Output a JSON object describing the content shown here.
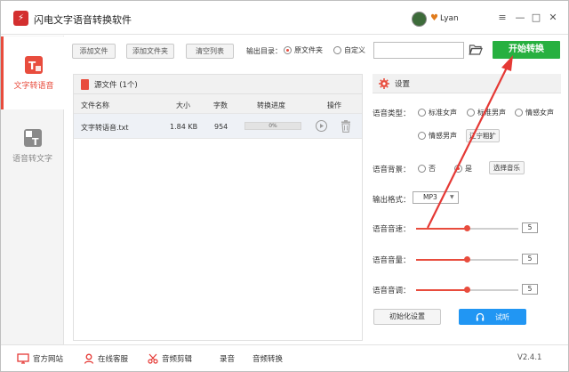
{
  "app": {
    "title": "闪电文字语音转换软件",
    "logo_glyph": "⚡",
    "user": "Lyan"
  },
  "window": {
    "menu_glyph": "≡",
    "minimize_glyph": "—",
    "maximize_glyph": "□",
    "close_glyph": "✕"
  },
  "sidebar": {
    "items": [
      {
        "label": "文字转语音",
        "active": true
      },
      {
        "label": "语音转文字",
        "active": false
      }
    ]
  },
  "toolbar": {
    "add_file": "添加文件",
    "add_folder": "添加文件夹",
    "clear_list": "清空列表",
    "output_dir_label": "输出目录：",
    "option_source": "原文件夹",
    "option_custom": "自定义",
    "path_value": "",
    "start_label": "开始转换"
  },
  "file_panel": {
    "header": "源文件 (1个)",
    "columns": [
      "文件名称",
      "大小",
      "字数",
      "转换进度",
      "操作"
    ],
    "rows": [
      {
        "name": "文字转语音.txt",
        "size": "1.84 KB",
        "chars": "954",
        "progress": "0%"
      }
    ]
  },
  "settings": {
    "title": "设置",
    "voice_type_label": "语音类型：",
    "voice_types": [
      "标准女声",
      "标准男声",
      "情感女声",
      "情感男声"
    ],
    "voice_selected_index": 3,
    "listen_button": "辽宁粗犷",
    "bg_label": "语音背景：",
    "bg_no": "否",
    "bg_yes": "是",
    "bg_selected": "是",
    "choose_music": "选择音乐",
    "format_label": "输出格式：",
    "format_value": "MP3",
    "speed_label": "语音音速：",
    "speed_value": "5",
    "volume_label": "语音音量：",
    "volume_value": "5",
    "pitch_label": "语音音调：",
    "pitch_value": "5",
    "reset_button": "初始化设置",
    "audition_button": "试听"
  },
  "footer": {
    "website": "官方网站",
    "service": "在线客服",
    "audio_edit": "音频剪辑",
    "record": "录音",
    "audio_convert": "音频转换",
    "version": "V2.4.1"
  },
  "colors": {
    "accent": "#e84c3d",
    "start": "#27b040",
    "audition": "#2196f3"
  }
}
